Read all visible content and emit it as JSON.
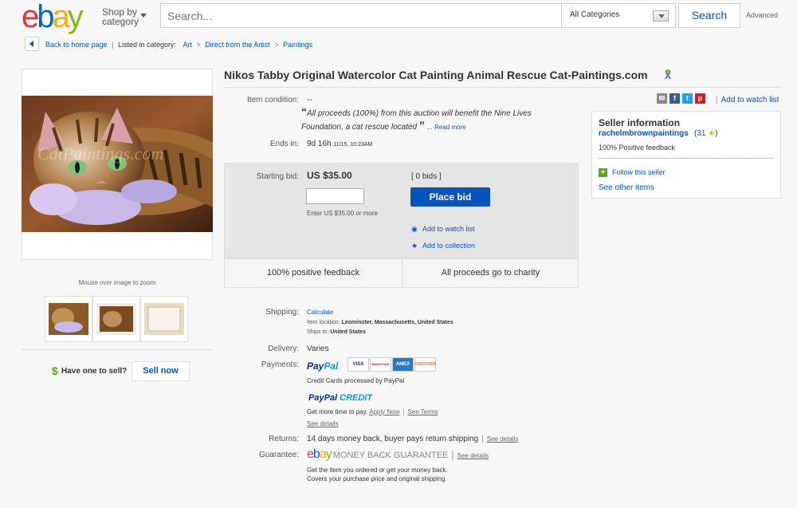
{
  "header": {
    "logo": [
      "e",
      "b",
      "a",
      "y"
    ],
    "shop_by_line1": "Shop by",
    "shop_by_line2": "category",
    "search_placeholder": "Search...",
    "category_select": "All Categories",
    "search_button": "Search",
    "advanced": "Advanced"
  },
  "breadcrumb": {
    "back": "Back to home page",
    "listed": "Listed in category:",
    "items": [
      "Art",
      "Direct from the Artist",
      "Paintings"
    ]
  },
  "gallery": {
    "watermark": "CatPaintings.com",
    "zoom_tip": "Mouse over image to zoom"
  },
  "sell": {
    "dollar": "$",
    "prompt": "Have one to sell?",
    "button": "Sell now"
  },
  "listing": {
    "title": "Nikos Tabby Original Watercolor Cat Painting Animal Rescue Cat-Paintings.com",
    "condition_label": "Item condition:",
    "condition_value": "--",
    "quote_open": "“",
    "quote": "All proceeds (100%) from this auction will benefit the Nine Lives Foundation, a cat rescue located",
    "quote_close": "”",
    "ellipsis": "...",
    "read_more": "Read more",
    "ends_label": "Ends in:",
    "ends_value": "9d 16h",
    "ends_date": "11/15, 10:23AM"
  },
  "bid": {
    "label": "Starting bid:",
    "price": "US $35.00",
    "bids": "[ 0 bids ]",
    "hint": "Enter US $35.00 or more",
    "place_bid": "Place bid",
    "watch": "Add to watch list",
    "collection": "Add to collection",
    "feedback": "100% positive feedback",
    "charity": "All proceeds go to charity"
  },
  "share": {
    "add_watch": "Add to watch list",
    "bar": "|"
  },
  "seller": {
    "heading": "Seller information",
    "name": "rachelmbrownpaintings",
    "score_open": "(",
    "score": "31",
    "score_close": ")",
    "feedback": "100% Positive feedback",
    "follow": "Follow this seller",
    "other": "See other items"
  },
  "details": {
    "shipping_label": "Shipping:",
    "calculate": "Calculate",
    "item_location_label": "Item location:",
    "item_location": "Leominster, Massachusetts, United States",
    "ships_to_label": "Ships to:",
    "ships_to": "United States",
    "delivery_label": "Delivery:",
    "delivery": "Varies",
    "payments_label": "Payments:",
    "paypal_1": "Pay",
    "paypal_2": "Pal",
    "cards": [
      "VISA",
      "MasterCard",
      "AMEX",
      "DISCOVER"
    ],
    "cc_note": "Credit Cards processed by PayPal",
    "ppc_1": "PayPal",
    "ppc_2": "CREDIT",
    "more_time": "Get more time to pay.",
    "apply_now": "Apply Now",
    "see_terms": "See Terms",
    "see_details": "See details",
    "returns_label": "Returns:",
    "returns": "14 days money back, buyer pays return shipping",
    "guarantee_label": "Guarantee:",
    "mbg": "MONEY BACK GUARANTEE",
    "guarantee_1": "Get the item you ordered or get your money back.",
    "guarantee_2": "Covers your purchase price and original shipping."
  },
  "colors": {
    "link": "#0654ba",
    "place_bid_bg": "#0654ba",
    "bid_box_bg": "#e5e5e5",
    "follow_green": "#5ba71b"
  },
  "icons": [
    "back-arrow-icon",
    "caret-down-icon",
    "ribbon-icon",
    "email-icon",
    "facebook-icon",
    "twitter-icon",
    "pinterest-icon",
    "eye-icon",
    "star-icon",
    "plus-icon",
    "gold-star-icon"
  ]
}
